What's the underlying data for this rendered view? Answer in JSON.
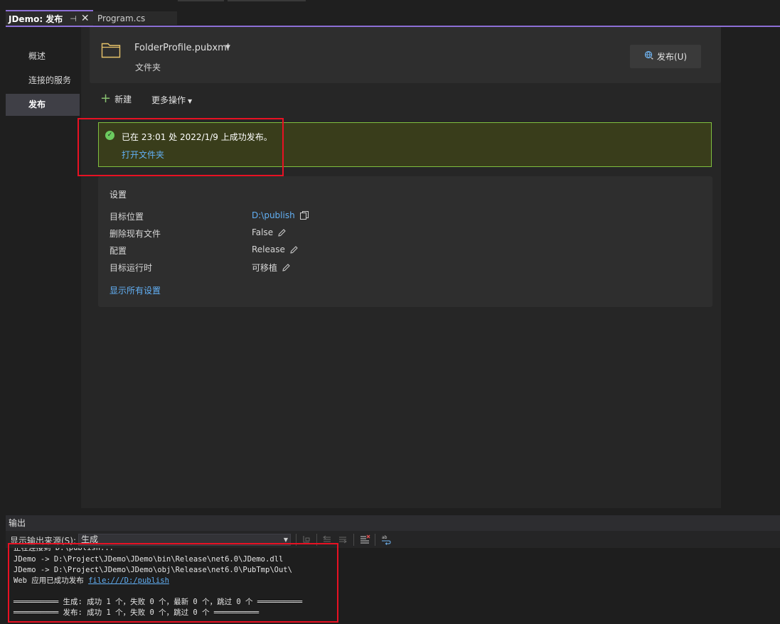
{
  "tabs": {
    "active_label": "JDemo: 发布",
    "pin_glyph": "⊣",
    "close_glyph": "✕",
    "inactive_label": "Program.cs"
  },
  "nav": {
    "items": [
      {
        "label": "概述"
      },
      {
        "label": "连接的服务"
      },
      {
        "label": "发布"
      }
    ]
  },
  "profile": {
    "name": "FolderProfile.pubxml",
    "type": "文件夹",
    "publish_button": "发布(U)"
  },
  "toolbar": {
    "new_label": "新建",
    "more_label": "更多操作"
  },
  "success": {
    "message": "已在 23:01 处 2022/1/9 上成功发布。",
    "open_folder": "打开文件夹"
  },
  "settings": {
    "title": "设置",
    "rows": [
      {
        "label": "目标位置",
        "value": "D:\\publish"
      },
      {
        "label": "删除现有文件",
        "value": "False"
      },
      {
        "label": "配置",
        "value": "Release"
      },
      {
        "label": "目标运行时",
        "value": "可移植"
      }
    ],
    "show_all": "显示所有设置"
  },
  "output": {
    "title": "输出",
    "source_label": "显示输出来源(S):",
    "source_value": "生成",
    "lines": [
      "正在连接到 D:\\publish...",
      "JDemo -> D:\\Project\\JDemo\\JDemo\\bin\\Release\\net6.0\\JDemo.dll",
      "JDemo -> D:\\Project\\JDemo\\JDemo\\obj\\Release\\net6.0\\PubTmp\\Out\\",
      "Web 应用已成功发布 ",
      "",
      "══════════ 生成: 成功 1 个，失败 0 个，最新 0 个，跳过 0 个 ══════════",
      "══════════ 发布: 成功 1 个，失败 0 个，跳过 0 个 ══════════"
    ],
    "publish_link": "file:///D:/publish"
  },
  "colors": {
    "accent": "#8c6fd6",
    "success_bg": "#393d1b",
    "success_border": "#7fbf3f",
    "link": "#62b0f5",
    "highlight": "#e81123"
  }
}
